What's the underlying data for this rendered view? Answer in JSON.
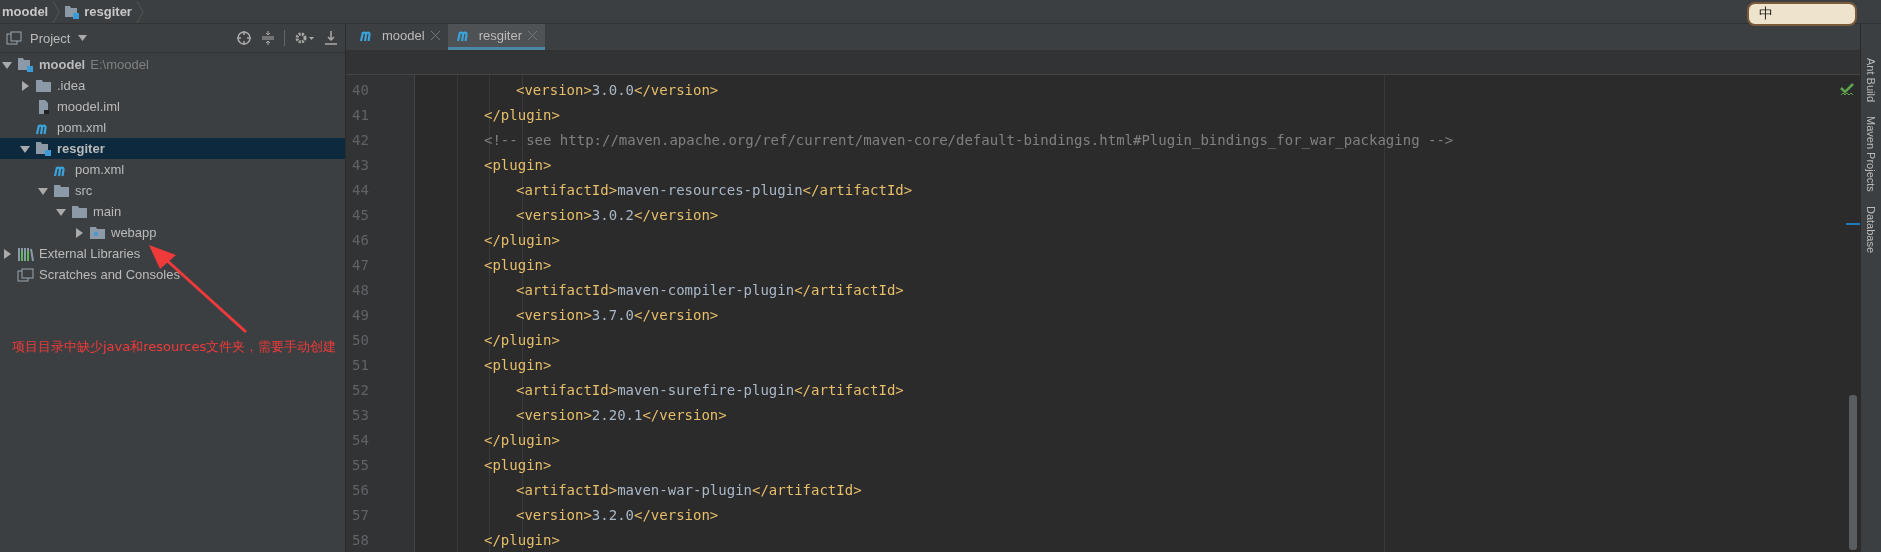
{
  "breadcrumb": [
    {
      "label": "moodel",
      "kind": "project"
    },
    {
      "label": "resgiter",
      "kind": "module"
    }
  ],
  "project_panel": {
    "title": "Project",
    "tree": [
      {
        "label": "moodel",
        "note": "E:\\moodel",
        "kind": "module",
        "expanded": true,
        "selected": false,
        "children": [
          {
            "label": ".idea",
            "kind": "folder",
            "expanded": false,
            "selected": false
          },
          {
            "label": "moodel.iml",
            "kind": "iml",
            "selected": false
          },
          {
            "label": "pom.xml",
            "kind": "maven",
            "selected": false
          },
          {
            "label": "resgiter",
            "kind": "module",
            "expanded": true,
            "selected": true,
            "children": [
              {
                "label": "pom.xml",
                "kind": "maven",
                "selected": false
              },
              {
                "label": "src",
                "kind": "folder",
                "expanded": true,
                "selected": false,
                "children": [
                  {
                    "label": "main",
                    "kind": "folder",
                    "expanded": true,
                    "selected": false,
                    "children": [
                      {
                        "label": "webapp",
                        "kind": "web-folder",
                        "expanded": false,
                        "selected": false
                      }
                    ]
                  }
                ]
              }
            ]
          }
        ]
      },
      {
        "label": "External Libraries",
        "kind": "libraries",
        "expanded": false,
        "selected": false
      },
      {
        "label": "Scratches and Consoles",
        "kind": "scratches",
        "selected": false
      }
    ]
  },
  "tabs": [
    {
      "label": "moodel",
      "selected": false
    },
    {
      "label": "resgiter",
      "selected": true
    }
  ],
  "editor": {
    "lines": [
      {
        "number": "40",
        "indented": true,
        "tokens": [
          {
            "kind": "tag",
            "text": "<version>"
          },
          {
            "kind": "text",
            "text": "3.0.0"
          },
          {
            "kind": "tag",
            "text": "</version>"
          }
        ]
      },
      {
        "number": "41",
        "indented": false,
        "tokens": [
          {
            "kind": "tag",
            "text": "</plugin>"
          }
        ]
      },
      {
        "number": "42",
        "indented": false,
        "tokens": [
          {
            "kind": "comment",
            "text": "<!-- see http://maven.apache.org/ref/current/maven-core/default-bindings.html#Plugin_bindings_for_war_packaging -->"
          }
        ]
      },
      {
        "number": "43",
        "indented": false,
        "tokens": [
          {
            "kind": "tag",
            "text": "<plugin>"
          }
        ]
      },
      {
        "number": "44",
        "indented": true,
        "tokens": [
          {
            "kind": "tag",
            "text": "<artifactId>"
          },
          {
            "kind": "text",
            "text": "maven-resources-plugin"
          },
          {
            "kind": "tag",
            "text": "</artifactId>"
          }
        ]
      },
      {
        "number": "45",
        "indented": true,
        "tokens": [
          {
            "kind": "tag",
            "text": "<version>"
          },
          {
            "kind": "text",
            "text": "3.0.2"
          },
          {
            "kind": "tag",
            "text": "</version>"
          }
        ]
      },
      {
        "number": "46",
        "indented": false,
        "tokens": [
          {
            "kind": "tag",
            "text": "</plugin>"
          }
        ]
      },
      {
        "number": "47",
        "indented": false,
        "tokens": [
          {
            "kind": "tag",
            "text": "<plugin>"
          }
        ]
      },
      {
        "number": "48",
        "indented": true,
        "tokens": [
          {
            "kind": "tag",
            "text": "<artifactId>"
          },
          {
            "kind": "text",
            "text": "maven-compiler-plugin"
          },
          {
            "kind": "tag",
            "text": "</artifactId>"
          }
        ]
      },
      {
        "number": "49",
        "indented": true,
        "tokens": [
          {
            "kind": "tag",
            "text": "<version>"
          },
          {
            "kind": "text",
            "text": "3.7.0"
          },
          {
            "kind": "tag",
            "text": "</version>"
          }
        ]
      },
      {
        "number": "50",
        "indented": false,
        "tokens": [
          {
            "kind": "tag",
            "text": "</plugin>"
          }
        ]
      },
      {
        "number": "51",
        "indented": false,
        "tokens": [
          {
            "kind": "tag",
            "text": "<plugin>"
          }
        ]
      },
      {
        "number": "52",
        "indented": true,
        "tokens": [
          {
            "kind": "tag",
            "text": "<artifactId>"
          },
          {
            "kind": "text",
            "text": "maven-surefire-plugin"
          },
          {
            "kind": "tag",
            "text": "</artifactId>"
          }
        ]
      },
      {
        "number": "53",
        "indented": true,
        "tokens": [
          {
            "kind": "tag",
            "text": "<version>"
          },
          {
            "kind": "text",
            "text": "2.20.1"
          },
          {
            "kind": "tag",
            "text": "</version>"
          }
        ]
      },
      {
        "number": "54",
        "indented": false,
        "tokens": [
          {
            "kind": "tag",
            "text": "</plugin>"
          }
        ]
      },
      {
        "number": "55",
        "indented": false,
        "tokens": [
          {
            "kind": "tag",
            "text": "<plugin>"
          }
        ]
      },
      {
        "number": "56",
        "indented": true,
        "tokens": [
          {
            "kind": "tag",
            "text": "<artifactId>"
          },
          {
            "kind": "text",
            "text": "maven-war-plugin"
          },
          {
            "kind": "tag",
            "text": "</artifactId>"
          }
        ]
      },
      {
        "number": "57",
        "indented": true,
        "tokens": [
          {
            "kind": "tag",
            "text": "<version>"
          },
          {
            "kind": "text",
            "text": "3.2.0"
          },
          {
            "kind": "tag",
            "text": "</version>"
          }
        ]
      },
      {
        "number": "58",
        "indented": false,
        "tokens": [
          {
            "kind": "tag",
            "text": "</plugin>"
          }
        ]
      }
    ]
  },
  "side_tools": [
    {
      "label": "Ant Build"
    },
    {
      "label": "Maven Projects"
    },
    {
      "label": "Database"
    }
  ],
  "ime_toolbar": {
    "label": "中"
  },
  "annotation": {
    "text": "项目目录中缺少java和resources文件夹，需要手动创建"
  }
}
